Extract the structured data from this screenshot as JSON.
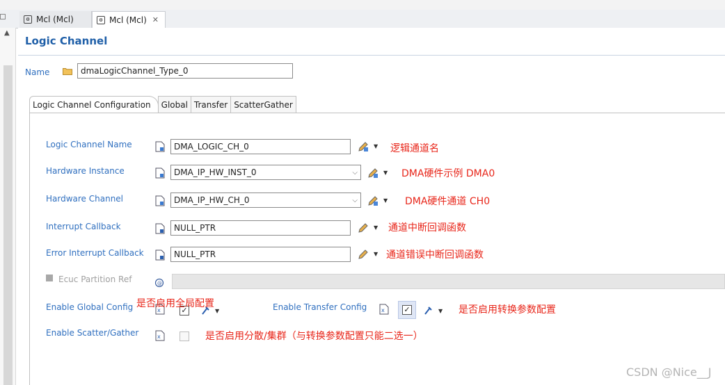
{
  "editor_tabs": [
    {
      "label": "Mcl (Mcl)",
      "active": false
    },
    {
      "label": "Mcl (Mcl)",
      "active": true
    }
  ],
  "page": {
    "title": "Logic Channel",
    "name_label": "Name",
    "name_value": "dmaLogicChannel_Type_0"
  },
  "sub_tabs": [
    "Logic Channel Configuration",
    "Global",
    "Transfer",
    "ScatterGather"
  ],
  "fields": {
    "logic_channel_name": {
      "label": "Logic Channel Name",
      "value": "DMA_LOGIC_CH_0",
      "annotation": "逻辑通道名"
    },
    "hardware_instance": {
      "label": "Hardware Instance",
      "value": "DMA_IP_HW_INST_0",
      "annotation": "DMA硬件示例 DMA0"
    },
    "hardware_channel": {
      "label": "Hardware Channel",
      "value": "DMA_IP_HW_CH_0",
      "annotation": "DMA硬件通道 CH0"
    },
    "interrupt_callback": {
      "label": "Interrupt Callback",
      "value": "NULL_PTR",
      "annotation": "通道中断回调函数"
    },
    "error_interrupt_callback": {
      "label": "Error Interrupt Callback",
      "value": "NULL_PTR",
      "annotation": "通道错误中断回调函数"
    },
    "ecuc_partition_ref": {
      "label": "Ecuc Partition Ref"
    },
    "enable_global_config": {
      "label": "Enable Global Config",
      "checked": true,
      "annotation": "是否启用全局配置"
    },
    "enable_transfer_config": {
      "label": "Enable Transfer Config",
      "checked": true,
      "annotation": "是否启用转换参数配置"
    },
    "enable_scatter_gather": {
      "label": "Enable Scatter/Gather",
      "checked": false,
      "annotation": "是否启用分散/集群（与转换参数配置只能二选一）"
    }
  },
  "watermark": "CSDN @Nice__J",
  "colors": {
    "label_blue": "#2f6fbf",
    "title_blue": "#1f5fa8",
    "annotation_red": "#e8261a"
  }
}
